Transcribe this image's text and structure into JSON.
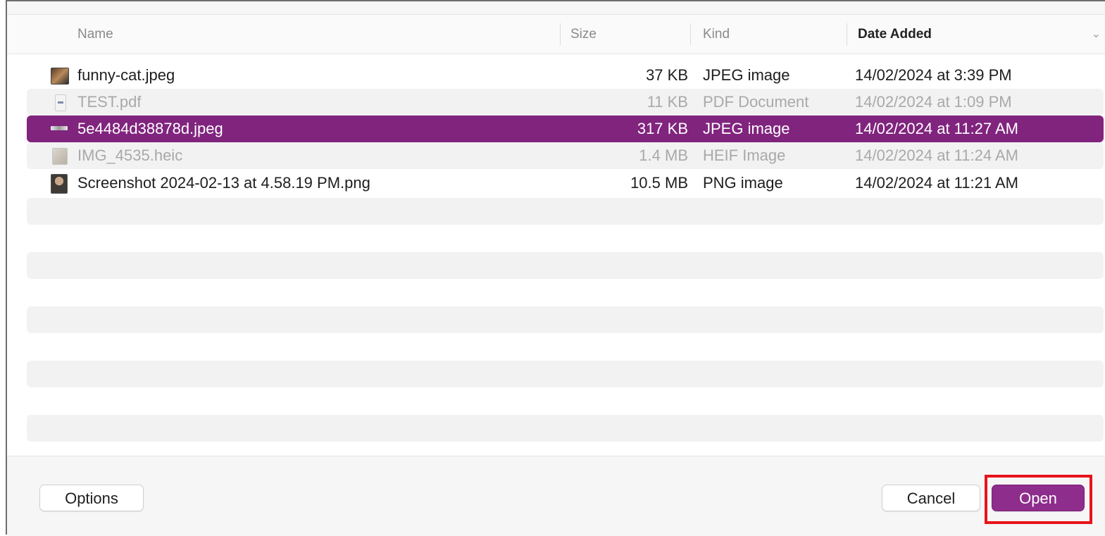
{
  "columns": {
    "name": "Name",
    "size": "Size",
    "kind": "Kind",
    "date_added": "Date Added"
  },
  "files": [
    {
      "name": "funny-cat.jpeg",
      "size": "37 KB",
      "kind": "JPEG image",
      "date": "14/02/2024 at 3:39 PM",
      "icon": "jpeg-thumbnail-icon",
      "state": "normal"
    },
    {
      "name": "TEST.pdf",
      "size": "11 KB",
      "kind": "PDF Document",
      "date": "14/02/2024 at 1:09 PM",
      "icon": "pdf-document-icon",
      "state": "disabled"
    },
    {
      "name": "5e4484d38878d.jpeg",
      "size": "317 KB",
      "kind": "JPEG image",
      "date": "14/02/2024 at 11:27 AM",
      "icon": "jpeg-thumbnail-icon",
      "state": "selected"
    },
    {
      "name": "IMG_4535.heic",
      "size": "1.4 MB",
      "kind": "HEIF Image",
      "date": "14/02/2024 at 11:24 AM",
      "icon": "heic-thumbnail-icon",
      "state": "disabled"
    },
    {
      "name": "Screenshot 2024-02-13 at 4.58.19 PM.png",
      "size": "10.5 MB",
      "kind": "PNG image",
      "date": "14/02/2024 at 11:21 AM",
      "icon": "png-thumbnail-icon",
      "state": "normal"
    }
  ],
  "footer": {
    "options_label": "Options",
    "cancel_label": "Cancel",
    "open_label": "Open"
  },
  "colors": {
    "selection": "#80247e",
    "primary_button": "#8e2d8c",
    "highlight": "#e8141b"
  }
}
